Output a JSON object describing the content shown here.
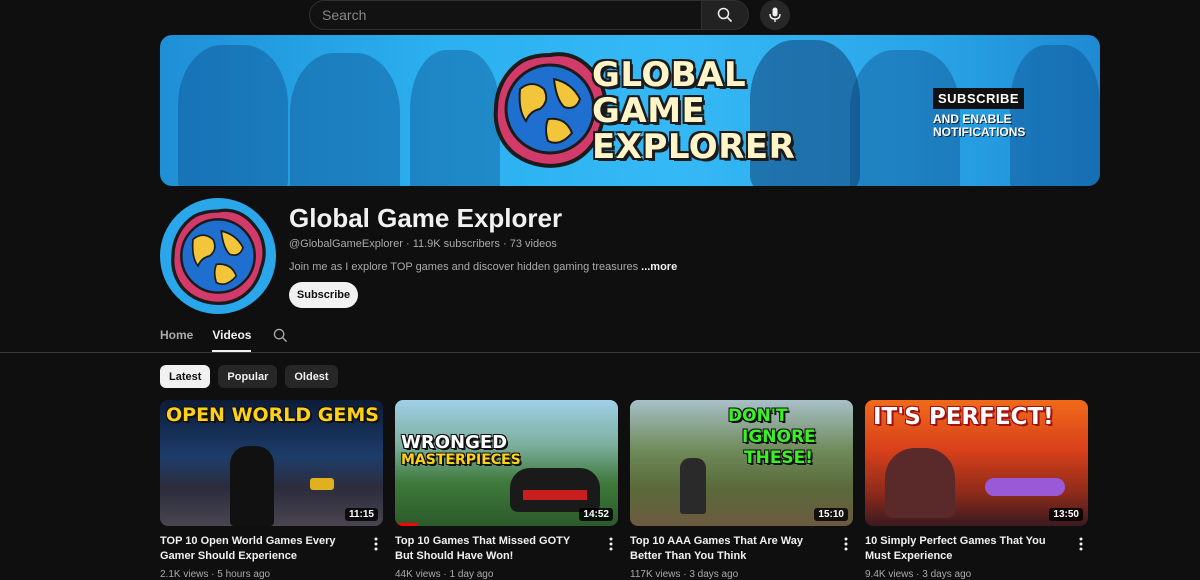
{
  "search": {
    "placeholder": "Search"
  },
  "banner": {
    "title_line1": "GLOBAL",
    "title_line2": "GAME",
    "title_line3": "EXPLORER",
    "subscribe": "SUBSCRIBE",
    "notif_line1": "AND ENABLE",
    "notif_line2": "NOTIFICATIONS"
  },
  "channel": {
    "name": "Global Game Explorer",
    "handle": "@GlobalGameExplorer",
    "subscribers": "11.9K subscribers",
    "videos_count": "73 videos",
    "separator": "·",
    "description": "Join me as I explore TOP games and discover hidden gaming treasures",
    "more": "...more",
    "subscribe_label": "Subscribe"
  },
  "tabs": [
    {
      "label": "Home",
      "active": false
    },
    {
      "label": "Videos",
      "active": true
    }
  ],
  "chips": [
    {
      "label": "Latest",
      "active": true
    },
    {
      "label": "Popular",
      "active": false
    },
    {
      "label": "Oldest",
      "active": false
    }
  ],
  "videos": [
    {
      "thumb_text": "OPEN WORLD GEMS",
      "duration": "11:15",
      "title": "TOP 10 Open World Games Every Gamer Should Experience",
      "views": "2.1K views",
      "age": "5 hours ago",
      "watched_fraction": 0
    },
    {
      "thumb_text_1": "WRONGED",
      "thumb_text_2": "MASTERPIECES",
      "duration": "14:52",
      "title": "Top 10 Games That Missed GOTY But Should Have Won!",
      "views": "44K views",
      "age": "1 day ago",
      "watched_fraction": 0.1
    },
    {
      "thumb_text_1": "DON'T",
      "thumb_text_2": "IGNORE",
      "thumb_text_3": "THESE!",
      "duration": "15:10",
      "title": "Top 10 AAA Games That Are Way Better Than You Think",
      "views": "117K views",
      "age": "3 days ago",
      "watched_fraction": 0
    },
    {
      "thumb_text": "IT'S PERFECT!",
      "duration": "13:50",
      "title": "10 Simply Perfect Games That You Must Experience",
      "views": "9.4K views",
      "age": "3 days ago",
      "watched_fraction": 0
    }
  ],
  "colors": {
    "accent": "#ff0000",
    "background": "#0f0f0f",
    "banner_blue": "#2bb0f0"
  }
}
